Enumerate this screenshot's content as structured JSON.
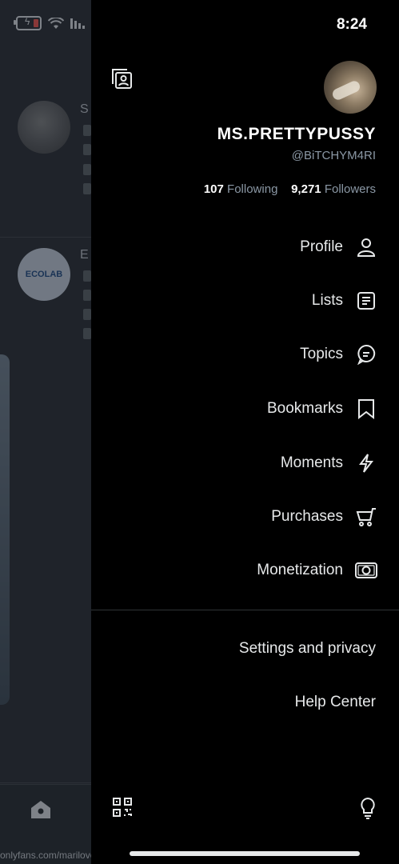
{
  "status": {
    "time": "8:24",
    "colors": {
      "battery_low": "#ff453a"
    }
  },
  "profile": {
    "display_name": "MS.PRETTYPUSSY",
    "handle": "@BiTCHYM4RI",
    "following_count": "107",
    "following_label": "Following",
    "followers_count": "9,271",
    "followers_label": "Followers"
  },
  "menu": [
    {
      "label": "Profile",
      "icon": "person-icon"
    },
    {
      "label": "Lists",
      "icon": "list-icon"
    },
    {
      "label": "Topics",
      "icon": "topics-icon"
    },
    {
      "label": "Bookmarks",
      "icon": "bookmark-icon"
    },
    {
      "label": "Moments",
      "icon": "lightning-icon"
    },
    {
      "label": "Purchases",
      "icon": "cart-icon"
    },
    {
      "label": "Monetization",
      "icon": "money-icon"
    }
  ],
  "secondary": {
    "settings": "Settings and privacy",
    "help": "Help Center"
  },
  "timeline": {
    "post2_avatar_text": "ECOLAB",
    "post1_letter": "S",
    "post2_letter": "E"
  },
  "watermark": "onlyfans.com/marilovee"
}
